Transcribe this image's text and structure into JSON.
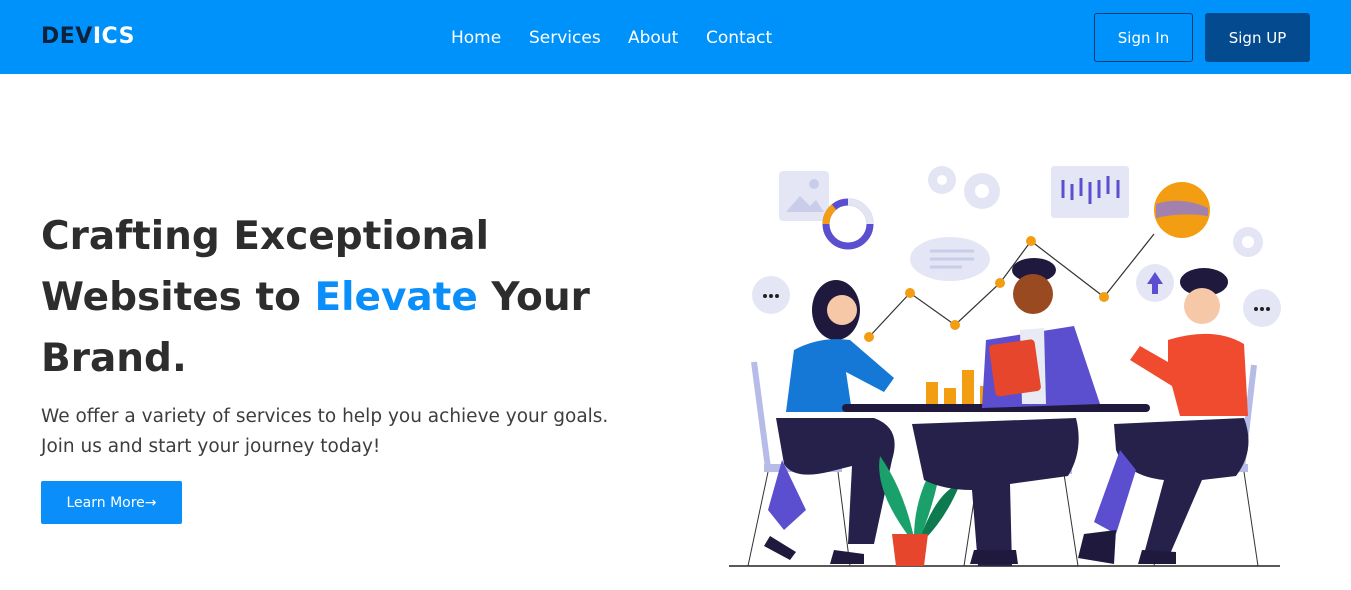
{
  "navbar": {
    "logo_part1": "DEV",
    "logo_part2": "ICS",
    "links": [
      "Home",
      "Services",
      "About",
      "Contact"
    ],
    "signin_label": "Sign In",
    "signup_label": "Sign UP"
  },
  "hero": {
    "title_line1": "Crafting Exceptional",
    "title_line2_prefix": "Websites to ",
    "title_accent": "Elevate",
    "title_line2_suffix": " Your",
    "title_line3": "Brand.",
    "subtitle_line1": "We offer a variety of services to help you achieve your goals.",
    "subtitle_line2": "Join us and start your journey today!",
    "cta_label": "Learn More",
    "cta_arrow": "→"
  },
  "colors": {
    "nav_bg": "#0092fb",
    "accent": "#0a8efa",
    "signup_bg": "#034a8f",
    "logo_dark": "#10213a"
  },
  "illustration": {
    "description_icon": "team-meeting-illustration"
  }
}
